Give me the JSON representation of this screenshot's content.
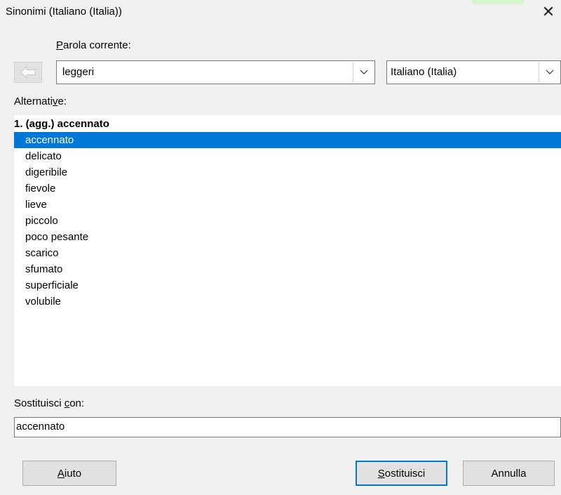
{
  "window": {
    "title": "Sinonimi (Italiano (Italia))",
    "close_glyph": "✕"
  },
  "current_word": {
    "label_prefix": "P",
    "label_rest": "arola corrente:",
    "value": "leggeri",
    "language": "Italiano (Italia)"
  },
  "alternatives": {
    "label_pre": "Alternati",
    "label_ul": "v",
    "label_post": "e:",
    "header": "1. (agg.) accennato",
    "items": [
      "accennato",
      "delicato",
      "digeribile",
      "fievole",
      "lieve",
      "piccolo",
      "poco pesante",
      "scarico",
      "sfumato",
      "superficiale",
      "volubile"
    ],
    "selected_index": 0,
    "selection_color": "#0078d7"
  },
  "replace": {
    "label_pre": "Sostituisci ",
    "label_ul": "c",
    "label_post": "on:",
    "value": "accennato"
  },
  "buttons": {
    "help_ul": "A",
    "help_rest": "iuto",
    "replace_ul": "S",
    "replace_rest": "ostituisci",
    "cancel": "Annulla"
  },
  "icons": {
    "back": "arrow-left-icon",
    "dropdown": "chevron-down-icon",
    "close": "close-icon"
  }
}
